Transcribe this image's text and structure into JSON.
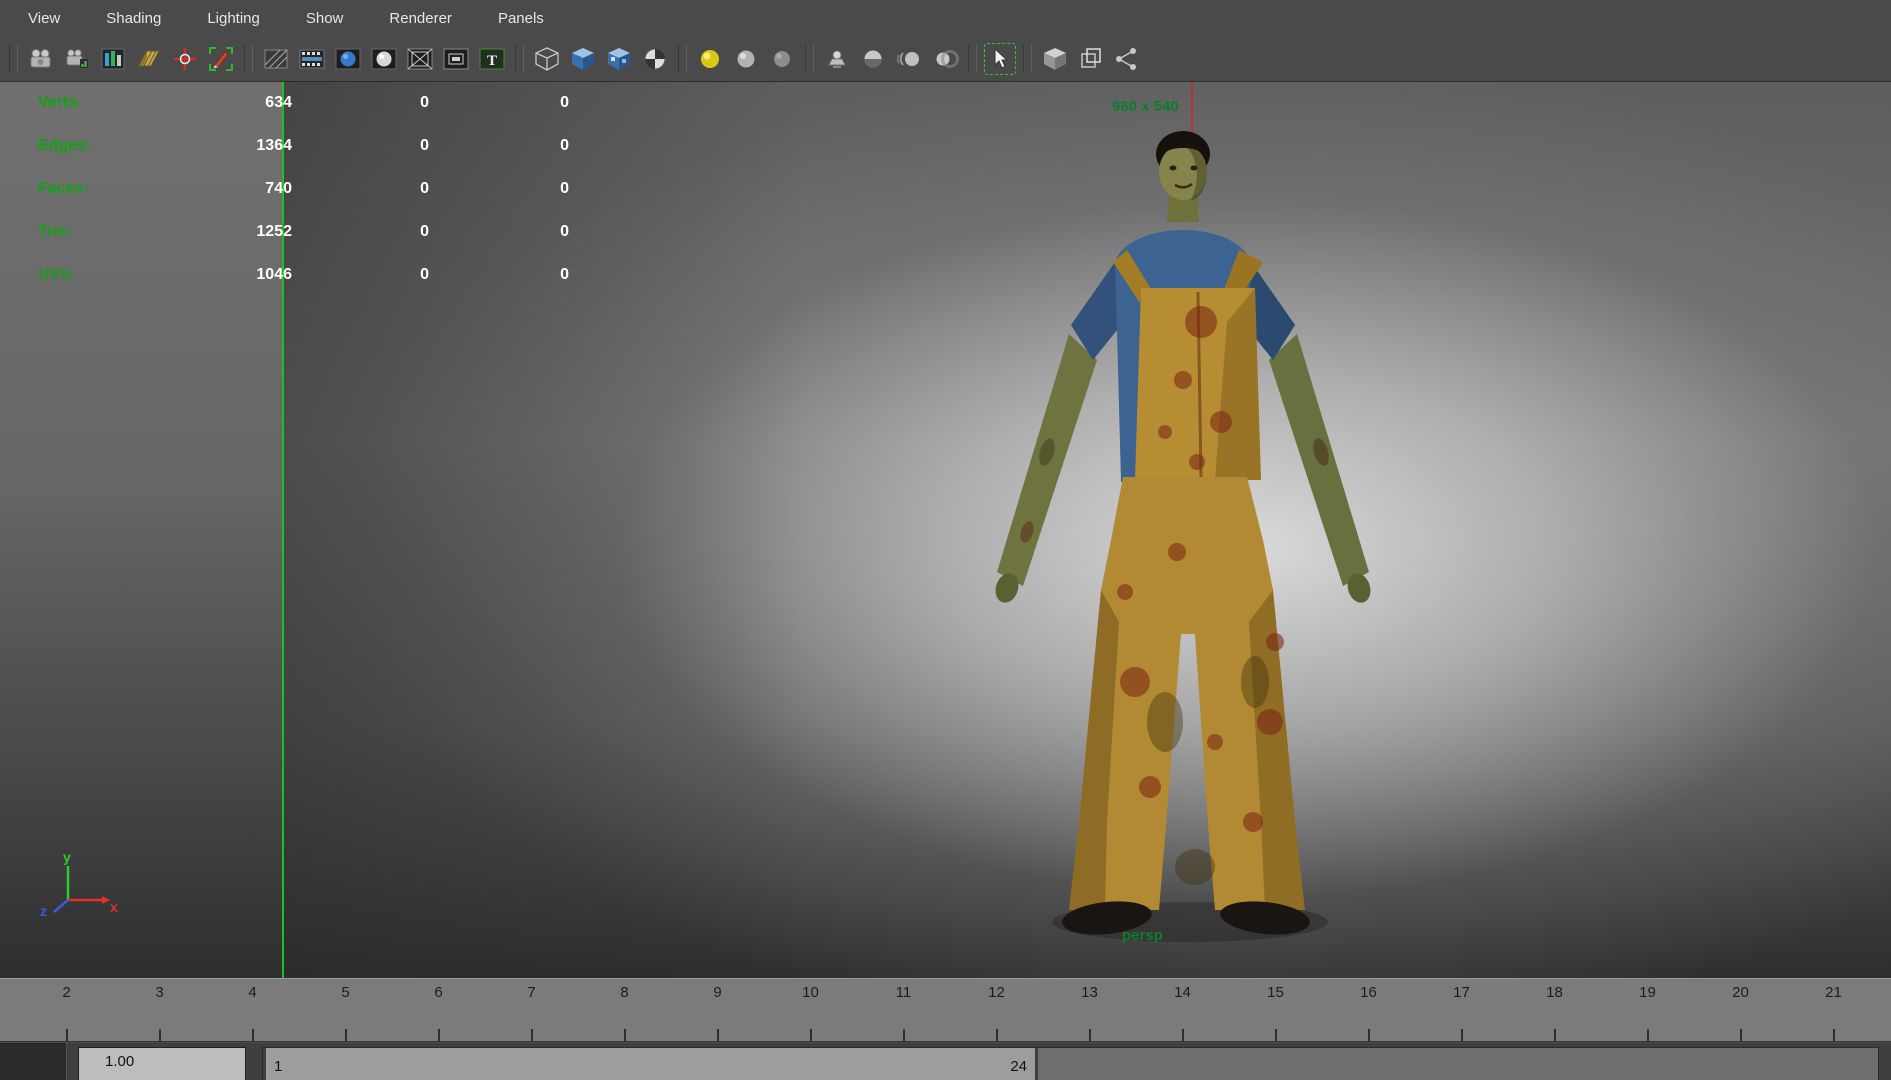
{
  "colors": {
    "hud_green": "#12a312",
    "gate_label_green": "#0f7d2d",
    "resolution_line_green": "#17c417",
    "gate_marker_red": "#b23434",
    "axis_x_red": "#e03030",
    "axis_y_green": "#2ecc2e",
    "axis_z_blue": "#3a5ae8",
    "toolbar_bg": "#4a4a4a",
    "timeline_bg": "#7b7b7b"
  },
  "menu": {
    "items": [
      {
        "label": "View"
      },
      {
        "label": "Shading"
      },
      {
        "label": "Lighting"
      },
      {
        "label": "Show"
      },
      {
        "label": "Renderer"
      },
      {
        "label": "Panels"
      }
    ]
  },
  "toolbar": {
    "icons": [
      "select-camera-icon",
      "camera-attributes-icon",
      "bookmarks-icon",
      "image-plane-icon",
      "2d-pan-zoom-icon",
      "grease-pencil-icon",
      "film-gate-icon",
      "resolution-gate-icon",
      "gate-mask-icon",
      "field-chart-icon",
      "safe-action-icon",
      "safe-title-icon",
      "hud-text-icon",
      "wireframe-cube-icon",
      "smooth-shade-cube-icon",
      "textured-cube-icon",
      "checkered-sphere-icon",
      "default-material-ball-icon",
      "light-ball-icon",
      "dim-light-ball-icon",
      "shadow-lamp-icon",
      "ssao-sphere-icon",
      "motion-blur-icon",
      "depth-of-field-icon",
      "select-cursor-icon",
      "solid-cube-icon",
      "cube-outline-icon",
      "share-nodes-icon"
    ]
  },
  "hud": {
    "rows": [
      {
        "label": "Verts:",
        "col1": "634",
        "col2": "0",
        "col3": "0"
      },
      {
        "label": "Edges:",
        "col1": "1364",
        "col2": "0",
        "col3": "0"
      },
      {
        "label": "Faces:",
        "col1": "740",
        "col2": "0",
        "col3": "0"
      },
      {
        "label": "Tris:",
        "col1": "1252",
        "col2": "0",
        "col3": "0"
      },
      {
        "label": "UVs:",
        "col1": "1046",
        "col2": "0",
        "col3": "0"
      }
    ]
  },
  "viewport": {
    "resolution_label": "960 x 540",
    "camera_label": "persp",
    "axis": {
      "x": "x",
      "y": "y",
      "z": "z"
    }
  },
  "timeline": {
    "frames": [
      "2",
      "3",
      "4",
      "5",
      "6",
      "7",
      "8",
      "9",
      "10",
      "11",
      "12",
      "13",
      "14",
      "15",
      "16",
      "17",
      "18",
      "19",
      "20",
      "21"
    ]
  },
  "playback": {
    "start_value": "1.00",
    "range_start": "1",
    "range_end": "24"
  }
}
